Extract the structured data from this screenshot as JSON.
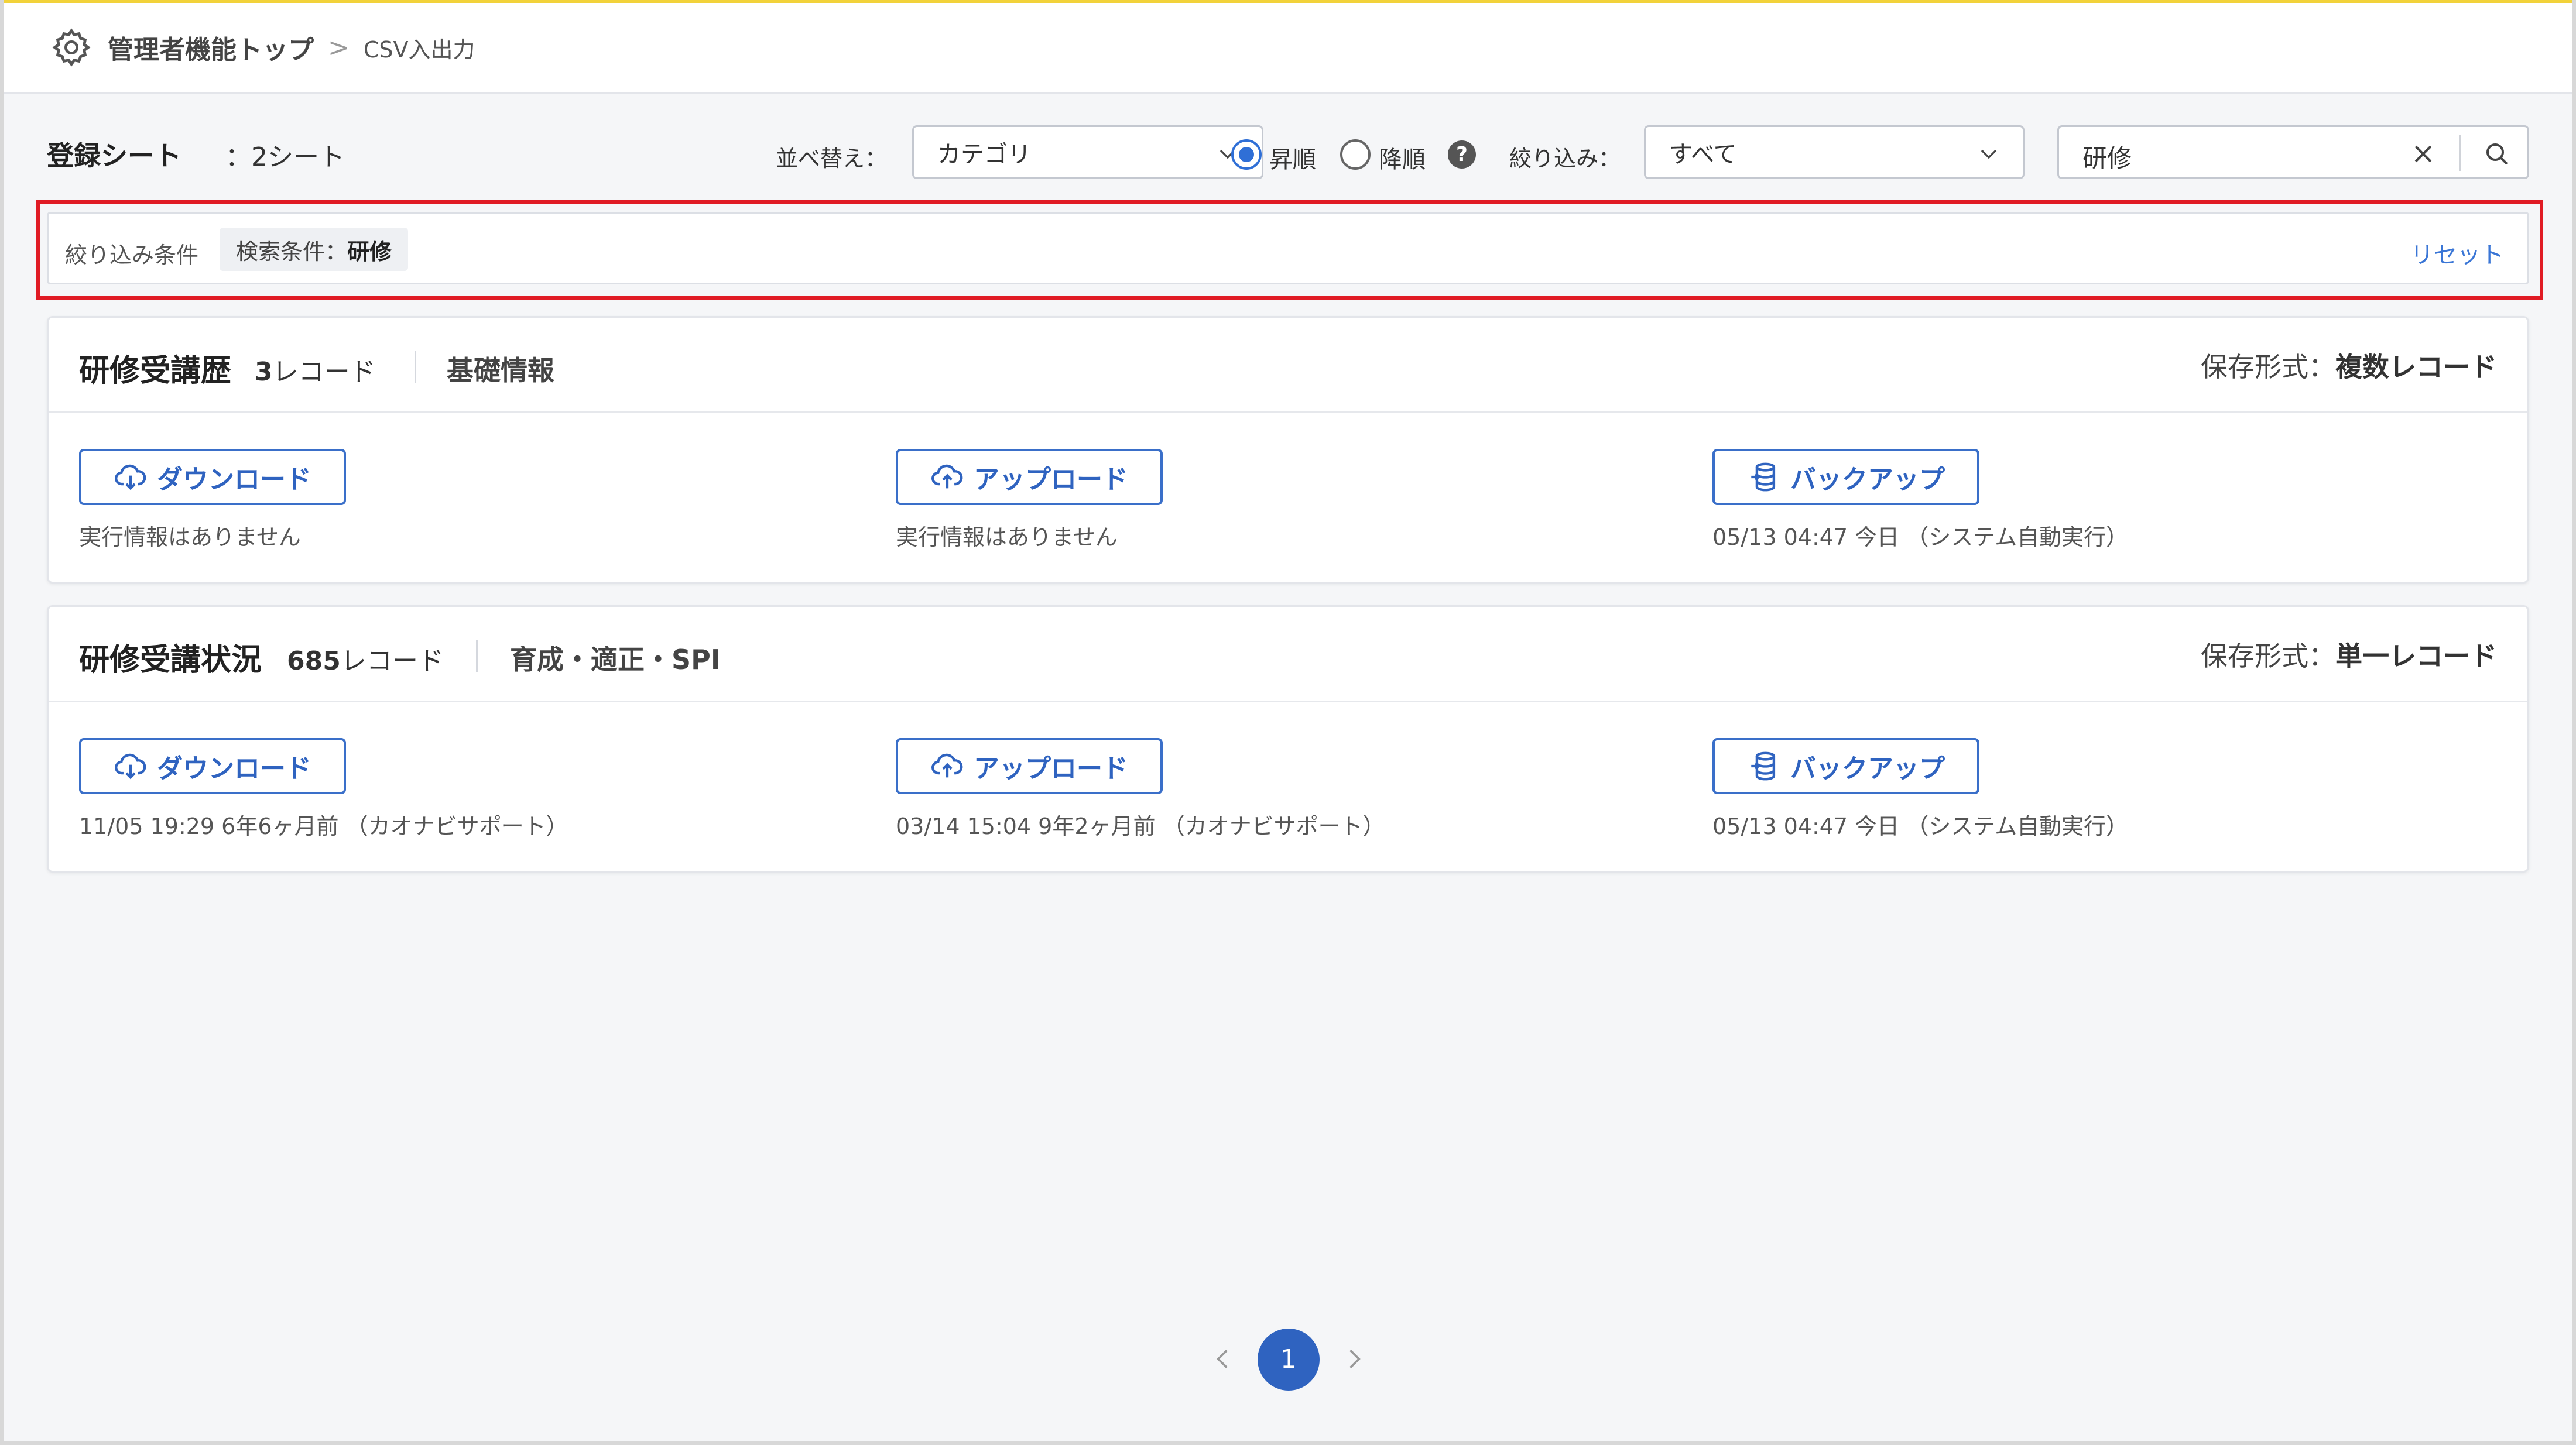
{
  "header": {
    "breadcrumb_main": "管理者機能トップ",
    "breadcrumb_sep": ">",
    "breadcrumb_current": "CSV入出力"
  },
  "toolbar": {
    "registered_label": "登録シート",
    "registered_count": "：2シート",
    "sort_label": "並べ替え：",
    "sort_value": "カテゴリ",
    "order_asc": "昇順",
    "order_desc": "降順",
    "order_selected": "asc",
    "help": "?",
    "filter_label": "絞り込み：",
    "filter_value": "すべて",
    "search_value": "研修"
  },
  "conditions": {
    "label": "絞り込み条件",
    "chip_prefix": "検索条件：",
    "chip_value": "研修",
    "reset": "リセット"
  },
  "cards": [
    {
      "title": "研修受講歴",
      "count_num": "3",
      "count_unit": "レコード",
      "category": "基礎情報",
      "format_prefix": "保存形式：",
      "format_value": "複数レコード",
      "download_label": "ダウンロード",
      "upload_label": "アップロード",
      "backup_label": "バックアップ",
      "download_info": "実行情報はありません",
      "upload_info": "実行情報はありません",
      "backup_info": "05/13 04:47 今日 （システム自動実行）"
    },
    {
      "title": "研修受講状況",
      "count_num": "685",
      "count_unit": "レコード",
      "category": "育成・適正・SPI",
      "format_prefix": "保存形式：",
      "format_value": "単一レコード",
      "download_label": "ダウンロード",
      "upload_label": "アップロード",
      "backup_label": "バックアップ",
      "download_info": "11/05 19:29 6年6ヶ月前 （カオナビサポート）",
      "upload_info": "03/14 15:04 9年2ヶ月前 （カオナビサポート）",
      "backup_info": "05/13 04:47 今日 （システム自動実行）"
    }
  ],
  "pagination": {
    "current_page": "1"
  },
  "colors": {
    "accent": "#2f63c0",
    "highlight_border": "#e01b24",
    "header_top_border": "#f2d23a"
  }
}
